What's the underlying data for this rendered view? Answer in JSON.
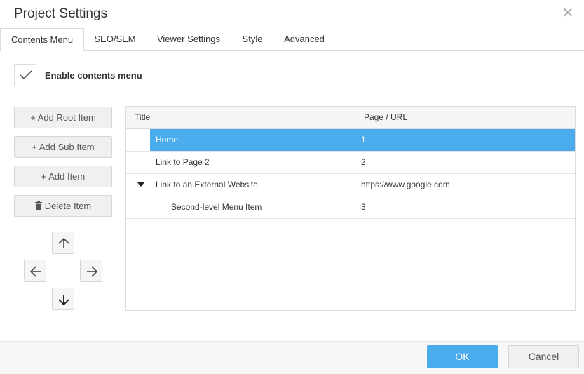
{
  "dialog": {
    "title": "Project Settings",
    "close_icon": "close-icon"
  },
  "tabs": [
    {
      "label": "Contents Menu",
      "active": true
    },
    {
      "label": "SEO/SEM"
    },
    {
      "label": "Viewer Settings"
    },
    {
      "label": "Style"
    },
    {
      "label": "Advanced"
    }
  ],
  "enable": {
    "label": "Enable contents menu",
    "checked": true
  },
  "actions": {
    "add_root": "+ Add Root Item",
    "add_sub": "+ Add Sub Item",
    "add_item": "+ Add Item",
    "delete": "Delete Item"
  },
  "grid": {
    "columns": [
      "Title",
      "Page / URL"
    ],
    "rows": [
      {
        "title": "Home",
        "url": "1",
        "level": 0,
        "selected": true
      },
      {
        "title": "Link to Page 2",
        "url": "2",
        "level": 0
      },
      {
        "title": "Link to an External Website",
        "url": "https://www.google.com",
        "level": 0,
        "expanded": true
      },
      {
        "title": "Second-level Menu Item",
        "url": "3",
        "level": 1
      }
    ]
  },
  "footer": {
    "ok": "OK",
    "cancel": "Cancel"
  },
  "colors": {
    "accent": "#4aabed",
    "border": "#dcdcdc",
    "button_bg": "#f0f0f0"
  }
}
